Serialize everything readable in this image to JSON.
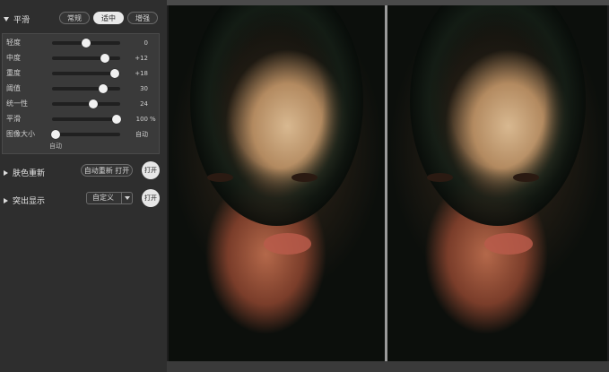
{
  "smooth": {
    "title": "平滑",
    "presets": [
      "常规",
      "适中",
      "增强"
    ],
    "active_preset": "适中",
    "sliders": [
      {
        "label": "轻度",
        "value": "0",
        "level": 0.5
      },
      {
        "label": "中度",
        "value": "+12",
        "level": 0.78
      },
      {
        "label": "重度",
        "value": "+18",
        "level": 0.92
      },
      {
        "label": "阈值",
        "value": "30",
        "level": 0.75
      },
      {
        "label": "统一性",
        "value": "24",
        "level": 0.6
      },
      {
        "label": "平滑",
        "value": "100",
        "unit": "%",
        "level": 0.95
      },
      {
        "label": "图像大小",
        "value": "自动",
        "level": 0.05
      }
    ],
    "auto_label": "自动"
  },
  "skin_tone": {
    "title": "肤色重新",
    "auto_button": "自动重新 打开",
    "toggle": "打开"
  },
  "highlight": {
    "title": "突出显示",
    "select_value": "自定义",
    "toggle": "打开"
  }
}
